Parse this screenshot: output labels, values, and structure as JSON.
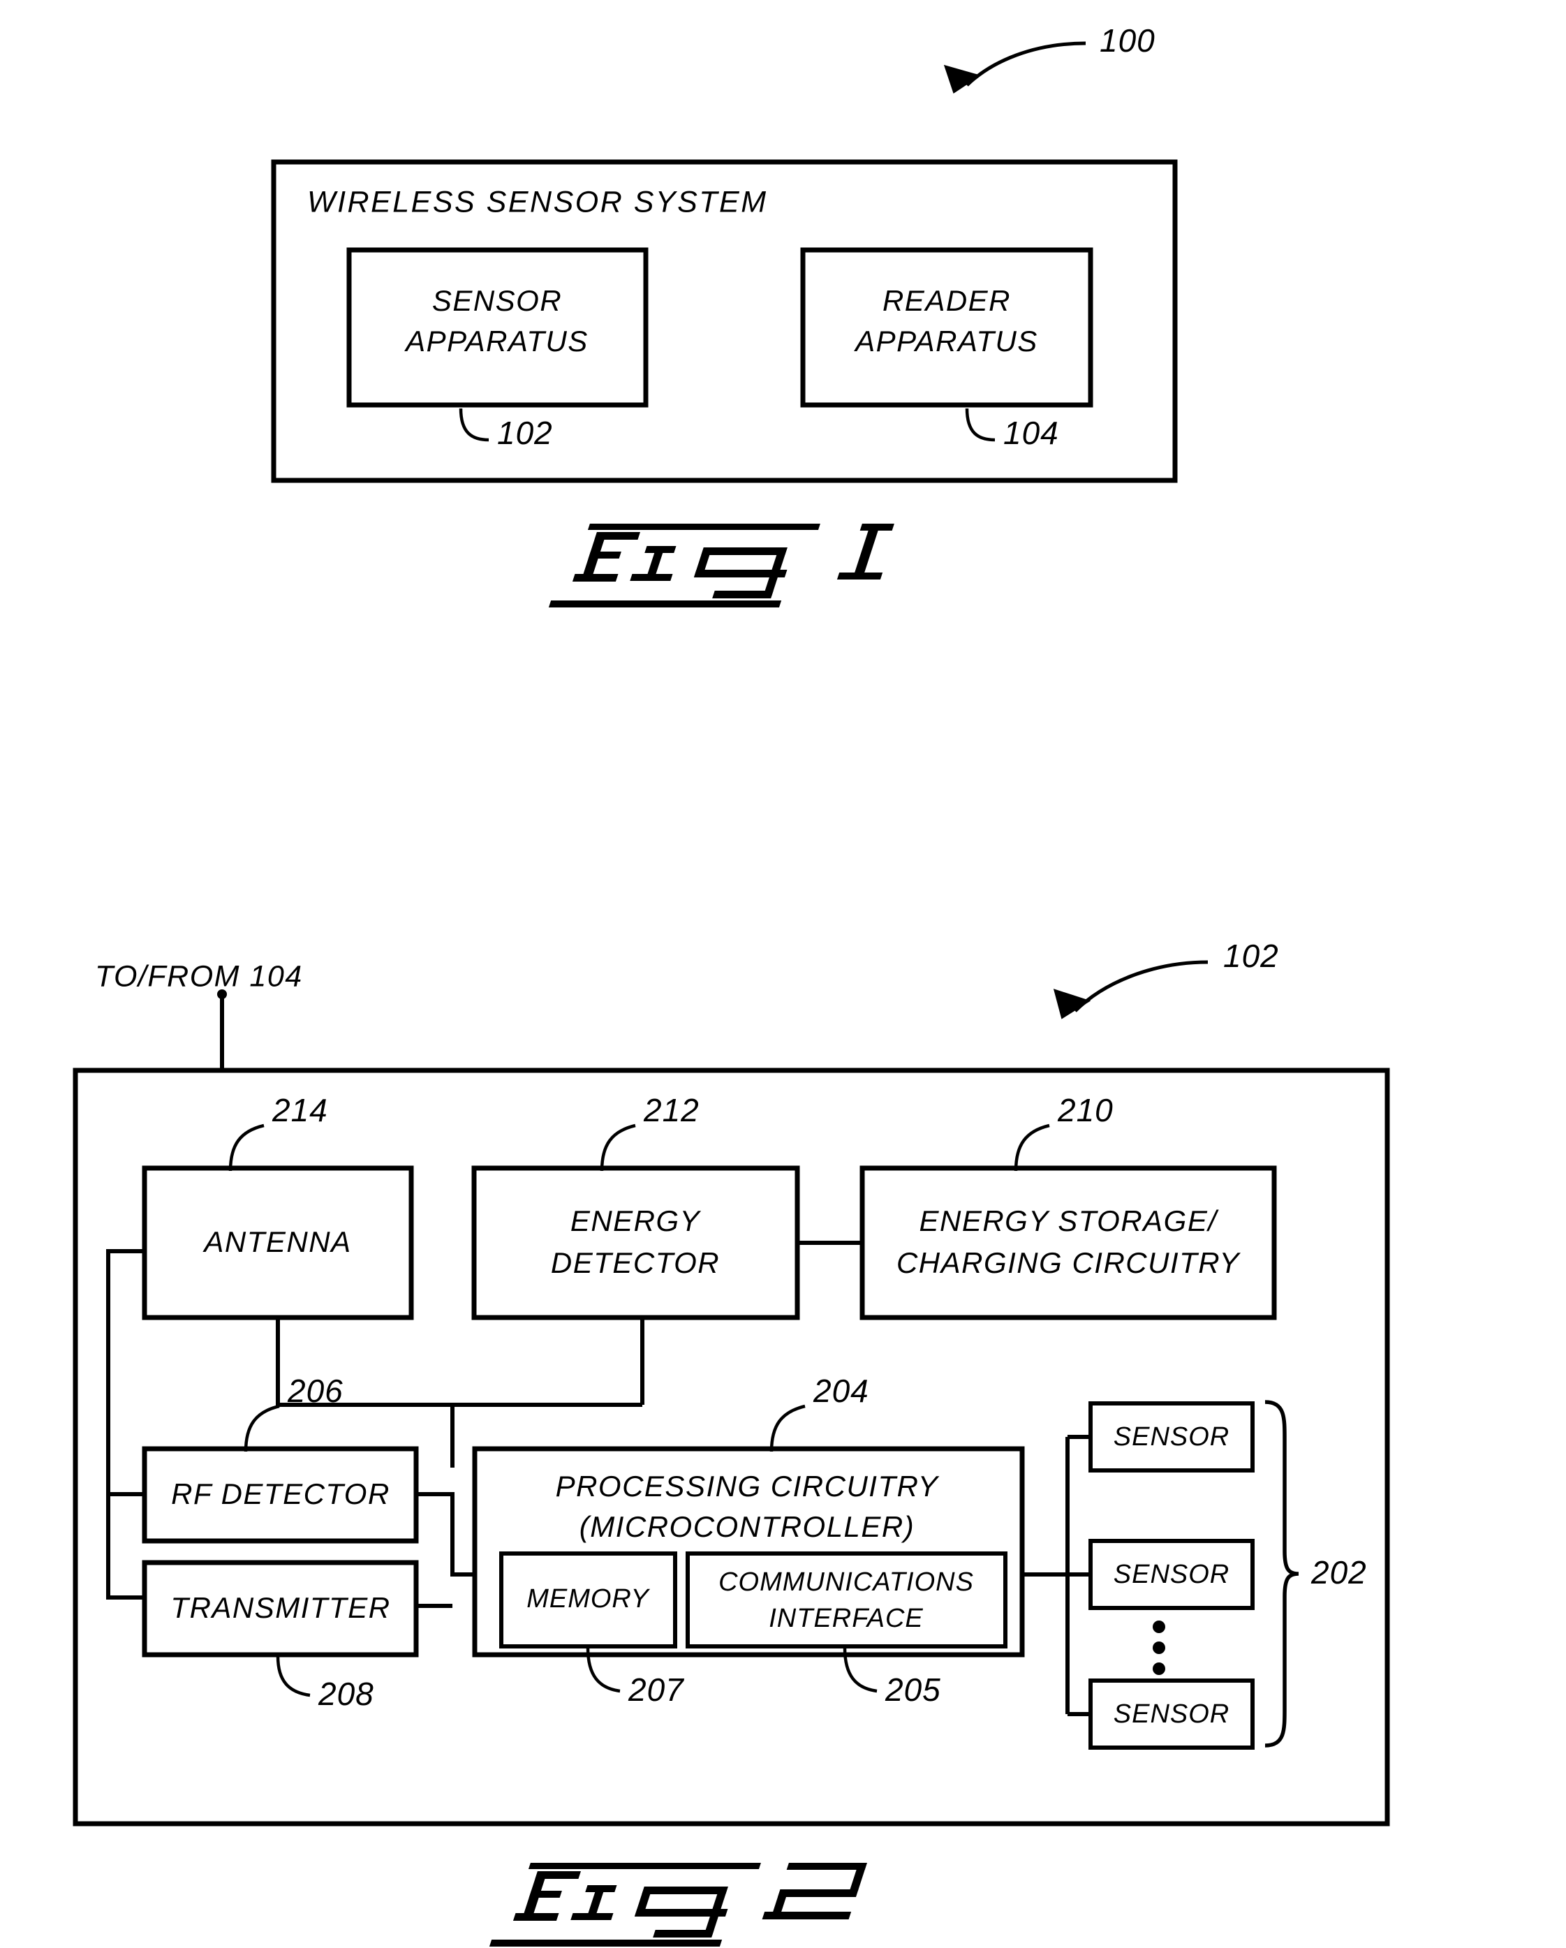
{
  "document": {
    "type": "patent-figure-sheet",
    "figures": [
      {
        "id": "fig1",
        "caption": "FIG. 1",
        "reference_numeral": "100",
        "outer_box_title": "WIRELESS SENSOR SYSTEM",
        "blocks": [
          {
            "label_line1": "SENSOR",
            "label_line2": "APPARATUS",
            "ref": "102"
          },
          {
            "label_line1": "READER",
            "label_line2": "APPARATUS",
            "ref": "104"
          }
        ]
      },
      {
        "id": "fig2",
        "caption": "FIG. 2",
        "reference_numeral": "102",
        "external_label": "TO/FROM  104",
        "blocks": [
          {
            "label": "ANTENNA",
            "ref": "214"
          },
          {
            "label_line1": "ENERGY",
            "label_line2": "DETECTOR",
            "ref": "212"
          },
          {
            "label_line1": "ENERGY STORAGE/",
            "label_line2": "CHARGING  CIRCUITRY",
            "ref": "210"
          },
          {
            "label": "RF  DETECTOR",
            "ref": "206"
          },
          {
            "label": "TRANSMITTER",
            "ref": "208"
          },
          {
            "label_line1": "PROCESSING  CIRCUITRY",
            "label_line2": "(MICROCONTROLLER)",
            "ref": "204"
          },
          {
            "label": "MEMORY",
            "ref": "207"
          },
          {
            "label_line1": "COMMUNICATIONS",
            "label_line2": "INTERFACE",
            "ref": "205"
          }
        ],
        "sensor_group": {
          "ref": "202",
          "items": [
            "SENSOR",
            "SENSOR",
            "SENSOR"
          ],
          "ellipsis": "vertical-dots"
        }
      }
    ],
    "colors": {
      "ink": "#000000",
      "paper": "#ffffff"
    }
  }
}
